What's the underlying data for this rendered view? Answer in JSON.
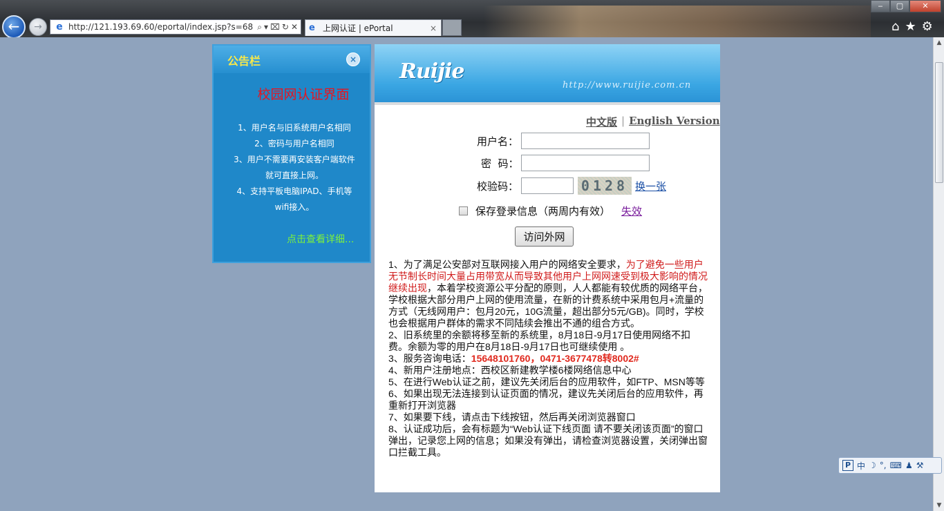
{
  "browser": {
    "url": "http://121.193.69.60/eportal/index.jsp?s=68",
    "tab_title": "上网认证 | ePortal",
    "tab_close": "×",
    "addr_tools": [
      "⌕",
      "▾",
      "⌧",
      "↻",
      "✕"
    ],
    "win_buttons": [
      "‒",
      "▢",
      "✕"
    ],
    "right_tools": [
      "⌂",
      "★",
      "⚙"
    ]
  },
  "notice": {
    "title": "公告栏",
    "close_glyph": "×",
    "heading": "校园网认证界面",
    "items": [
      "1、用户名与旧系统用户名相同",
      "2、密码与用户名相同",
      "3、用户不需要再安装客户端软件就可直接上网。",
      "4、支持平板电脑IPAD、手机等wifi接入。"
    ],
    "more_link": "点击查看详细..."
  },
  "header": {
    "logo": "Ruijie",
    "site_url": "http://www.ruijie.com.cn"
  },
  "lang": {
    "chinese": "中文版",
    "separator": "|",
    "english": "English Version"
  },
  "form": {
    "username_label": "用户名：",
    "username_value": "",
    "password_label": "密  码：",
    "password_value": "",
    "captcha_label": "校验码：",
    "captcha_value": "",
    "captcha_image_text": "0128",
    "refresh_link": "换一张",
    "remember_label": "保存登录信息（两周内有效）",
    "remember_checked": false,
    "invalidate_link": "失效",
    "submit_label": "访问外网"
  },
  "notes": {
    "n1_a": "1、为了满足公安部对互联网接入用户的网络安全要求，",
    "n1_red": "为了避免一些用户无节制长时间大量占用带宽从而导致其他用户上网网速受到极大影响的情况继续出现",
    "n1_b": "，本着学校资源公平分配的原则，人人都能有较优质的网络平台，学校根据大部分用户上网的使用流量，在新的计费系统中采用包月+流量的方式（无线网用户：包月20元，10G流量，超出部分5元/GB)。同时，学校也会根据用户群体的需求不同陆续会推出不通的组合方式。",
    "n2": "2、旧系统里的余额将移至新的系统里，8月18日-9月17日使用网络不扣费。余额为零的用户在8月18日-9月17日也可继续使用 。",
    "n3_a": "3、服务咨询电话：",
    "n3_phone": "15648101760，0471-3677478转8002#",
    "n4": "4、新用户注册地点：西校区新建教学楼6楼网络信息中心",
    "n5": "5、在进行Web认证之前，建议先关闭后台的应用软件，如FTP、MSN等等",
    "n6": "6、如果出现无法连接到认证页面的情况，建议先关闭后台的应用软件，再重新打开浏览器",
    "n7": "7、如果要下线，请点击下线按钮，然后再关闭浏览器窗口",
    "n8": "8、认证成功后，会有标题为“Web认证下线页面 请不要关闭该页面”的窗口弹出，记录您上网的信息；如果没有弹出，请检查浏览器设置，关闭弹出窗口拦截工具。"
  },
  "ime": {
    "items": [
      "P",
      "中",
      "☽",
      "°,",
      "⌨",
      "♟",
      "⚒"
    ]
  }
}
